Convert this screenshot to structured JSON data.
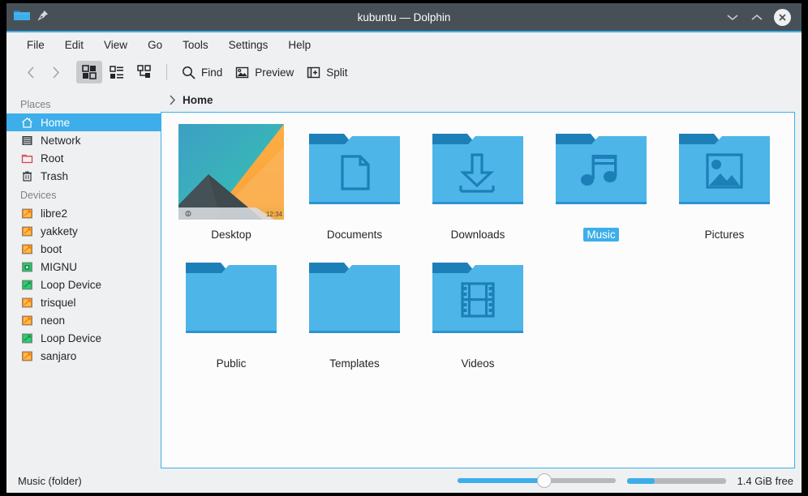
{
  "window": {
    "title": "kubuntu — Dolphin",
    "app_icon": "folder-icon",
    "pin_icon": "pin-icon",
    "minimize_icon": "chevron-down-icon",
    "maximize_icon": "chevron-up-icon",
    "close_icon": "close-icon",
    "accent_color": "#3daee9",
    "titlebar_color": "#475057"
  },
  "menubar": {
    "items": [
      {
        "label": "File"
      },
      {
        "label": "Edit"
      },
      {
        "label": "View"
      },
      {
        "label": "Go"
      },
      {
        "label": "Tools"
      },
      {
        "label": "Settings"
      },
      {
        "label": "Help"
      }
    ]
  },
  "toolbar": {
    "back_label": "Back",
    "forward_label": "Forward",
    "view_icons_label": "Icons",
    "view_details_label": "Details",
    "view_compact_label": "Compact",
    "find_label": "Find",
    "preview_label": "Preview",
    "split_label": "Split"
  },
  "sidebar": {
    "sections": [
      {
        "title": "Places",
        "items": [
          {
            "label": "Home",
            "icon": "home-icon",
            "selected": true
          },
          {
            "label": "Network",
            "icon": "network-icon",
            "selected": false
          },
          {
            "label": "Root",
            "icon": "root-folder-icon",
            "selected": false
          },
          {
            "label": "Trash",
            "icon": "trash-icon",
            "selected": false
          }
        ]
      },
      {
        "title": "Devices",
        "items": [
          {
            "label": "libre2",
            "icon": "drive-partition-icon",
            "selected": false
          },
          {
            "label": "yakkety",
            "icon": "drive-partition-icon",
            "selected": false
          },
          {
            "label": "boot",
            "icon": "drive-partition-icon",
            "selected": false
          },
          {
            "label": "MIGNU",
            "icon": "drive-optical-icon",
            "selected": false
          },
          {
            "label": "Loop Device",
            "icon": "drive-loop-icon",
            "selected": false
          },
          {
            "label": "trisquel",
            "icon": "drive-partition-icon",
            "selected": false
          },
          {
            "label": "neon",
            "icon": "drive-partition-icon",
            "selected": false
          },
          {
            "label": "Loop Device",
            "icon": "drive-loop-icon",
            "selected": false
          },
          {
            "label": "sanjaro",
            "icon": "drive-partition-icon",
            "selected": false
          }
        ]
      }
    ]
  },
  "breadcrumb": {
    "chevron_icon": "chevron-right-icon",
    "path": "Home"
  },
  "view": {
    "items": [
      {
        "label": "Desktop",
        "kind": "wallpaper-thumbnail",
        "selected": false,
        "clock": "12:34"
      },
      {
        "label": "Documents",
        "kind": "folder",
        "emblem": "document-emblem",
        "selected": false
      },
      {
        "label": "Downloads",
        "kind": "folder",
        "emblem": "download-emblem",
        "selected": false
      },
      {
        "label": "Music",
        "kind": "folder",
        "emblem": "music-note-emblem",
        "selected": true
      },
      {
        "label": "Pictures",
        "kind": "folder",
        "emblem": "image-emblem",
        "selected": false
      },
      {
        "label": "Public",
        "kind": "folder",
        "emblem": "none",
        "selected": false
      },
      {
        "label": "Templates",
        "kind": "folder",
        "emblem": "none",
        "selected": false
      },
      {
        "label": "Videos",
        "kind": "folder",
        "emblem": "film-emblem",
        "selected": false
      }
    ]
  },
  "statusbar": {
    "selection_text": "Music (folder)",
    "zoom_percent": 55,
    "space_used_percent": 28,
    "free_space": "1.4 GiB free"
  }
}
